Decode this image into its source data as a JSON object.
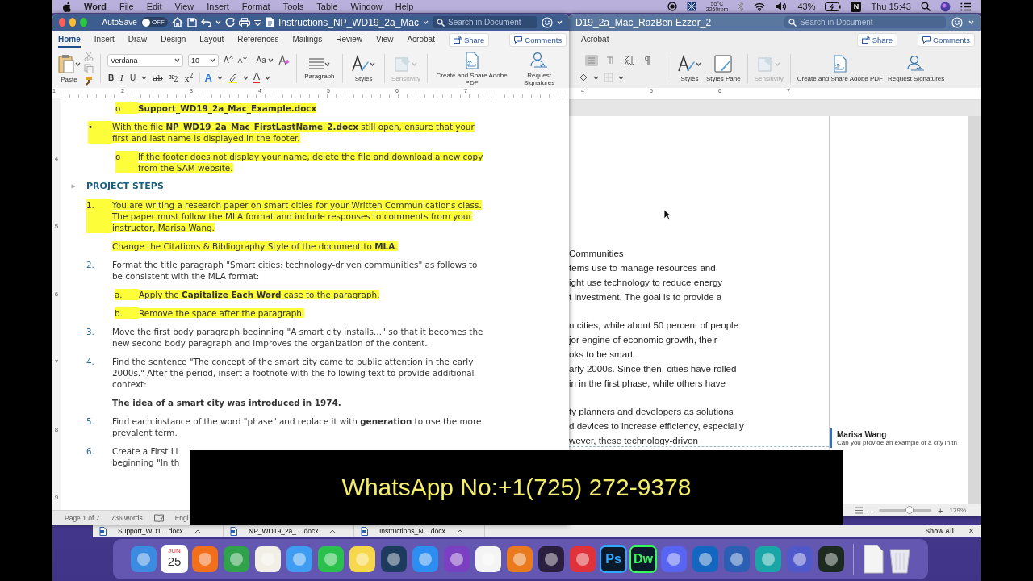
{
  "menu_bar": {
    "app": "Word",
    "menus": [
      "File",
      "Edit",
      "View",
      "Insert",
      "Format",
      "Tools",
      "Table",
      "Window",
      "Help"
    ],
    "temperature": "55°C",
    "fan_speed": "2260rpm",
    "battery": "43%",
    "app_badge": "N",
    "clock": "Thu 15:43"
  },
  "front_window": {
    "autosave": {
      "label": "AutoSave",
      "toggle_text": "OFF",
      "on": false
    },
    "title": "Instructions_NP_WD19_2a_Mac",
    "search": {
      "placeholder": "Search in Document"
    },
    "tabs": [
      {
        "label": "Home",
        "selected": true
      },
      {
        "label": "Insert",
        "selected": false
      },
      {
        "label": "Draw",
        "selected": false
      },
      {
        "label": "Design",
        "selected": false
      },
      {
        "label": "Layout",
        "selected": false
      },
      {
        "label": "References",
        "selected": false
      },
      {
        "label": "Mailings",
        "selected": false
      },
      {
        "label": "Review",
        "selected": false
      },
      {
        "label": "View",
        "selected": false
      },
      {
        "label": "Acrobat",
        "selected": false
      }
    ],
    "share": "Share",
    "comments": "Comments",
    "ribbon": {
      "paste": "Paste",
      "font": "Verdana",
      "font_size": "10",
      "grow_shrink": [
        "A",
        "A"
      ],
      "case_button": "Aa",
      "format_buttons": [
        {
          "kind": "bold",
          "label": "B"
        },
        {
          "kind": "italic",
          "label": "I"
        },
        {
          "kind": "underline",
          "label": "U"
        },
        {
          "kind": "strike",
          "label": "ab"
        },
        {
          "kind": "script",
          "label": "x$_{2}$"
        },
        {
          "kind": "script",
          "label": "x$^{2}$"
        }
      ],
      "text_effects": "A",
      "font_color": "A",
      "paragraph": "Paragraph",
      "styles": "Styles",
      "sensitivity": {
        "label": "Sensitivity",
        "disabled": true
      },
      "create_pdf": "Create and Share Adobe PDF",
      "request_signatures": "Request Signatures"
    },
    "ruler": [
      "1",
      "2",
      "3",
      "4",
      "5",
      "6",
      "7"
    ],
    "vertical_ruler": [
      "4",
      "5",
      "6",
      "7",
      "8",
      "9"
    ],
    "document": [
      {
        "kind": "sub",
        "marker": "o",
        "lines": [
          "**Support_WD19_2a_Mac_Example.docx**"
        ],
        "highlighted": true
      },
      {
        "kind": "bullet",
        "marker": "•",
        "lines": [
          "With the file **NP_WD19_2a_Mac_FirstLastName_2.docx** still open, ensure that your",
          "first and last name is displayed in the footer."
        ],
        "highlighted": true
      },
      {
        "kind": "sub",
        "marker": "o",
        "lines": [
          "If the footer does not display your name, delete the file and download a new copy",
          "from the SAM website."
        ],
        "highlighted": true
      },
      {
        "kind": "heading",
        "lines": [
          "PROJECT STEPS"
        ],
        "highlighted": false
      },
      {
        "kind": "numbered",
        "marker": "1.",
        "lines": [
          "You are writing a research paper on smart cities for your Written Communications class.",
          "The paper must follow the MLA format and include responses to comments from your",
          "instructor, Marisa Wang."
        ],
        "highlighted": true
      },
      {
        "kind": "plain",
        "lines": [
          "Change the Citations & Bibliography Style of the document to **MLA**."
        ],
        "highlighted": true
      },
      {
        "kind": "numbered",
        "marker": "2.",
        "lines": [
          "Format the title paragraph \"Smart cities: technology-driven communities\" as follows to",
          "be consistent with the MLA format:"
        ],
        "highlighted": false
      },
      {
        "kind": "letter",
        "marker": "a.",
        "lines": [
          "Apply the **Capitalize Each Word** case to the paragraph."
        ],
        "highlighted": true
      },
      {
        "kind": "letter",
        "marker": "b.",
        "lines": [
          "Remove the space after the paragraph."
        ],
        "highlighted": true
      },
      {
        "kind": "numbered",
        "marker": "3.",
        "lines": [
          "Move the first body paragraph beginning \"A smart city installs…\" so that it becomes the",
          "new second body paragraph and improves the organization of the content."
        ],
        "highlighted": false
      },
      {
        "kind": "numbered",
        "marker": "4.",
        "lines": [
          "Find the sentence \"The concept of the smart city came to public attention in the early",
          "2000s.\" After the period, insert a footnote with the following text to provide additional",
          "context:"
        ],
        "highlighted": false
      },
      {
        "kind": "note",
        "lines": [
          "The idea of a smart city was introduced in 1974."
        ],
        "highlighted": false
      },
      {
        "kind": "numbered",
        "marker": "5.",
        "lines": [
          "Find each instance of the word \"phase\" and replace it with **generation** to use the more",
          "prevalent term."
        ],
        "highlighted": false
      },
      {
        "kind": "numbered",
        "marker": "6.",
        "lines": [
          "Create a First Li",
          "beginning \"In th"
        ],
        "highlighted": false
      }
    ],
    "status_bar": {
      "page": "Page 1 of 7",
      "words": "736 words",
      "language": "Engl"
    }
  },
  "back_window": {
    "title": "D19_2a_Mac_RazBen Ezzer_2",
    "search": {
      "placeholder": "Search in Document"
    },
    "tab": {
      "label": "Acrobat",
      "selected": false
    },
    "share": "Share",
    "comments": "Comments",
    "ribbon": {
      "styles": "Styles",
      "styles_pane": "Styles Pane",
      "sensitivity": {
        "label": "Sensitivity",
        "disabled": true
      },
      "create_pdf": "Create and Share Adobe PDF",
      "request_signatures": "Request Signatures"
    },
    "ruler": [
      "4",
      "5",
      "6",
      "7"
    ],
    "document": [
      {
        "lines": [
          "Communities",
          "tems use to manage resources and",
          "ight use technology to reduce energy",
          "t investment. The goal is to provide a"
        ]
      },
      {
        "lines": [
          "n cities, while about 50 percent of people",
          "jor engine of economic growth, their",
          "oks to be smart.",
          "arly 2000s. Since then, cities have rolled",
          "in in the first phase, while others have"
        ]
      },
      {
        "lines": [
          "ty planners and developers as solutions",
          "d devices to increase efficiency, especially",
          "wever, these technology-driven"
        ]
      }
    ],
    "comment": {
      "author": "Marisa Wang",
      "text": "Can you provide an example of a city in th"
    },
    "zoom": {
      "zoom_out": "-",
      "level": 0.58,
      "zoom_in": "+",
      "reading": "179%"
    }
  },
  "downloads": {
    "items": [
      "Support_WD1....docx",
      "NP_WD19_2a_....docx",
      "Instructions_N....docx"
    ],
    "show_all": "Show All",
    "close": "×"
  },
  "dock": [
    {
      "kind": "app",
      "color": "#3b8be0"
    },
    {
      "kind": "calendar",
      "month": "JUN",
      "day": "25"
    },
    {
      "kind": "app",
      "color": "#f2701c"
    },
    {
      "kind": "app",
      "color": "#2fa24b"
    },
    {
      "kind": "app",
      "color": "#f1efe6"
    },
    {
      "kind": "app",
      "color": "#3e9df2"
    },
    {
      "kind": "app",
      "color": "#29c14b"
    },
    {
      "kind": "app",
      "color": "#f7d84b"
    },
    {
      "kind": "app",
      "color": "#1d3b5c"
    },
    {
      "kind": "app",
      "color": "#2c8ef0"
    },
    {
      "kind": "app",
      "color": "#7b3fc2"
    },
    {
      "kind": "app",
      "color": "#f4f4f4"
    },
    {
      "kind": "app",
      "color": "#e97a1d"
    },
    {
      "kind": "app",
      "color": "#2a1f3e"
    },
    {
      "kind": "app",
      "color": "#e0323a"
    },
    {
      "kind": "letter",
      "label": "Ps",
      "color": "#31a8ff"
    },
    {
      "kind": "letter",
      "label": "Dw",
      "color": "#36fa5a"
    },
    {
      "kind": "app",
      "color": "#5865f2"
    },
    {
      "kind": "app",
      "color": "#1467c0"
    },
    {
      "kind": "app",
      "color": "#2b5fb4"
    },
    {
      "kind": "app",
      "color": "#1aa6a6"
    },
    {
      "kind": "app",
      "color": "#5059c9"
    },
    {
      "kind": "app",
      "color": "#1c2a22"
    },
    {
      "kind": "separator"
    },
    {
      "kind": "document"
    },
    {
      "kind": "trash"
    }
  ],
  "overlay_banner": {
    "text": "WhatsApp No:+1(725) 272-9378"
  }
}
